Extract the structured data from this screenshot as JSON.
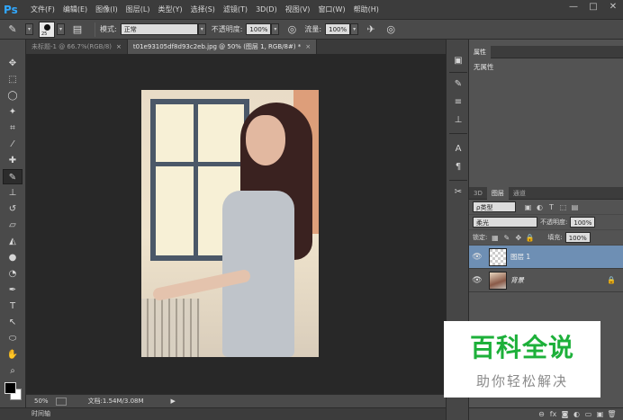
{
  "app": {
    "logo": "Ps"
  },
  "menu": [
    "文件(F)",
    "编辑(E)",
    "图像(I)",
    "图层(L)",
    "类型(Y)",
    "选择(S)",
    "滤镜(T)",
    "3D(D)",
    "视图(V)",
    "窗口(W)",
    "帮助(H)"
  ],
  "window_controls": {
    "minimize": "—",
    "restore": "□",
    "close": "✕"
  },
  "options": {
    "brush_size": "25",
    "mode_label": "模式:",
    "mode_value": "正常",
    "opacity_label": "不透明度:",
    "opacity_value": "100%",
    "flow_label": "流量:",
    "flow_value": "100%"
  },
  "tabs": [
    {
      "label": "未标题-1 @ 66.7%(RGB/8)",
      "close": "×"
    },
    {
      "label": "t01e93105df8d93c2eb.jpg @ 50% (图层 1, RGB/8#) *",
      "close": "×"
    }
  ],
  "status": {
    "zoom": "50%",
    "doc": "文档:1.54M/3.08M"
  },
  "timeline": {
    "label": "时间轴"
  },
  "properties": {
    "tab": "属性",
    "body": "无属性"
  },
  "layers_panel": {
    "tabs": [
      "3D",
      "图层",
      "通道"
    ],
    "filter_kind": "ρ类型",
    "blend_mode": "柔光",
    "opacity_label": "不透明度:",
    "opacity_value": "100%",
    "lock_label": "锁定:",
    "fill_label": "填充:",
    "fill_value": "100%",
    "layers": [
      {
        "name": "图层 1",
        "selected": true
      },
      {
        "name": "背景",
        "selected": false
      }
    ]
  },
  "watermark": {
    "title": "百科全说",
    "subtitle": "助你轻松解决"
  }
}
